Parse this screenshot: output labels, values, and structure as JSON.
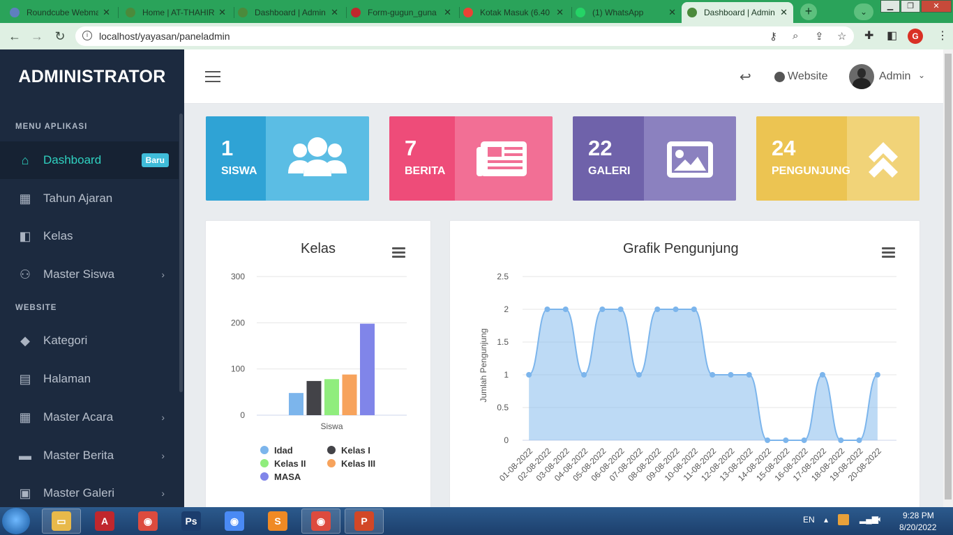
{
  "browser": {
    "tabs": [
      {
        "title": "Roundcube Webmail",
        "fav_color": "#5e7fbf"
      },
      {
        "title": "Home | AT-THAHIR",
        "fav_color": "#4b8a3b"
      },
      {
        "title": "Dashboard | Admin",
        "fav_color": "#4b8a3b"
      },
      {
        "title": "Form-gugun_guna",
        "fav_color": "#c0272d"
      },
      {
        "title": "Kotak Masuk (6.40",
        "fav_color": "#ea4335"
      },
      {
        "title": "(1) WhatsApp",
        "fav_color": "#25d366"
      },
      {
        "title": "Dashboard | Admin",
        "fav_color": "#4b8a3b"
      }
    ],
    "close_glyph": "✕",
    "new_tab": "+",
    "tab_search": "⌄",
    "url": "localhost/yayasan/paneladmin",
    "win_min": "▁",
    "win_max": "❐",
    "win_close": "✕",
    "profile_letter": "G"
  },
  "sidebar": {
    "brand": "ADMINISTRATOR",
    "menu_header": "MENU APLIKASI",
    "website_header": "WEBSITE",
    "items": [
      {
        "label": "Dashboard",
        "icon": "home-icon",
        "glyph": "⌂",
        "badge": "Baru",
        "active": true
      },
      {
        "label": "Tahun Ajaran",
        "icon": "calendar-icon",
        "glyph": "▦"
      },
      {
        "label": "Kelas",
        "icon": "cubes-icon",
        "glyph": "◧"
      },
      {
        "label": "Master Siswa",
        "icon": "users-icon",
        "glyph": "⚇",
        "chevron": "›"
      },
      {
        "label": "Kategori",
        "icon": "tag-icon",
        "glyph": "◆"
      },
      {
        "label": "Halaman",
        "icon": "file-icon",
        "glyph": "▤"
      },
      {
        "label": "Master Acara",
        "icon": "calendar-icon",
        "glyph": "▦",
        "chevron": "›"
      },
      {
        "label": "Master Berita",
        "icon": "newspaper-icon",
        "glyph": "▬",
        "chevron": "›"
      },
      {
        "label": "Master Galeri",
        "icon": "image-icon",
        "glyph": "▣",
        "chevron": "›"
      }
    ]
  },
  "topnav": {
    "back_glyph": "↩",
    "website_label": "Website",
    "user_name": "Admin",
    "caret": "⌄"
  },
  "stats": [
    {
      "value": "1",
      "label": "SISWA",
      "icon": "users-icon",
      "color_dark": "#2fa3d5",
      "color_light": "#5bbde4"
    },
    {
      "value": "7",
      "label": "BERITA",
      "icon": "newspaper-icon",
      "color_dark": "#ee4c79",
      "color_light": "#f26f95"
    },
    {
      "value": "22",
      "label": "GALERI",
      "icon": "image-icon",
      "color_dark": "#6f62aa",
      "color_light": "#8b81bf"
    },
    {
      "value": "24",
      "label": "PENGUNJUNG",
      "icon": "chevrons-up-icon",
      "color_dark": "#ecc452",
      "color_light": "#f1d378"
    }
  ],
  "chart_data": [
    {
      "type": "bar",
      "title": "Kelas",
      "categories": [
        "Siswa"
      ],
      "series": [
        {
          "name": "Idad",
          "values": [
            48
          ],
          "color": "#7cb5ec"
        },
        {
          "name": "Kelas I",
          "values": [
            74
          ],
          "color": "#434348"
        },
        {
          "name": "Kelas II",
          "values": [
            78
          ],
          "color": "#90ed7d"
        },
        {
          "name": "Kelas III",
          "values": [
            88
          ],
          "color": "#f7a35c"
        },
        {
          "name": "MASA",
          "values": [
            198
          ],
          "color": "#8085e9"
        }
      ],
      "yticks": [
        "0",
        "100",
        "200",
        "300"
      ],
      "ylim": [
        0,
        300
      ],
      "legend": "bottom",
      "grid": true
    },
    {
      "type": "area",
      "title": "Grafik Pengunjung",
      "ylabel": "Jumlah Pengunjung",
      "x": [
        "01-08-2022",
        "02-08-2022",
        "03-08-2022",
        "04-08-2022",
        "05-08-2022",
        "06-08-2022",
        "07-08-2022",
        "08-08-2022",
        "09-08-2022",
        "10-08-2022",
        "11-08-2022",
        "12-08-2022",
        "13-08-2022",
        "14-08-2022",
        "15-08-2022",
        "16-08-2022",
        "17-08-2022",
        "18-08-2022",
        "19-08-2022",
        "20-08-2022"
      ],
      "values": [
        1,
        2,
        2,
        1,
        2,
        2,
        1,
        2,
        2,
        2,
        1,
        1,
        1,
        0,
        0,
        0,
        1,
        0,
        0,
        1
      ],
      "yticks": [
        "0",
        "0.5",
        "1",
        "1.5",
        "2",
        "2.5"
      ],
      "ylim": [
        0,
        2.5
      ],
      "color": "#7cb5ec",
      "grid": true
    }
  ],
  "taskbar": {
    "lang": "EN",
    "time": "9:28 PM",
    "date": "8/20/2022",
    "apps": [
      {
        "name": "explorer-icon",
        "glyph": "▭",
        "color": "#e8b94a"
      },
      {
        "name": "acrobat-icon",
        "glyph": "A",
        "color": "#c0272d"
      },
      {
        "name": "chrome-profile-icon",
        "glyph": "◉",
        "color": "#dd4b3e"
      },
      {
        "name": "photoshop-icon",
        "glyph": "Ps",
        "color": "#1b3d6d"
      },
      {
        "name": "chrome-icon",
        "glyph": "◉",
        "color": "#4a8af4"
      },
      {
        "name": "sublime-icon",
        "glyph": "S",
        "color": "#f08a24"
      },
      {
        "name": "chrome-active-icon",
        "glyph": "◉",
        "color": "#dd4b3e"
      },
      {
        "name": "powerpoint-icon",
        "glyph": "P",
        "color": "#d24726"
      }
    ]
  }
}
